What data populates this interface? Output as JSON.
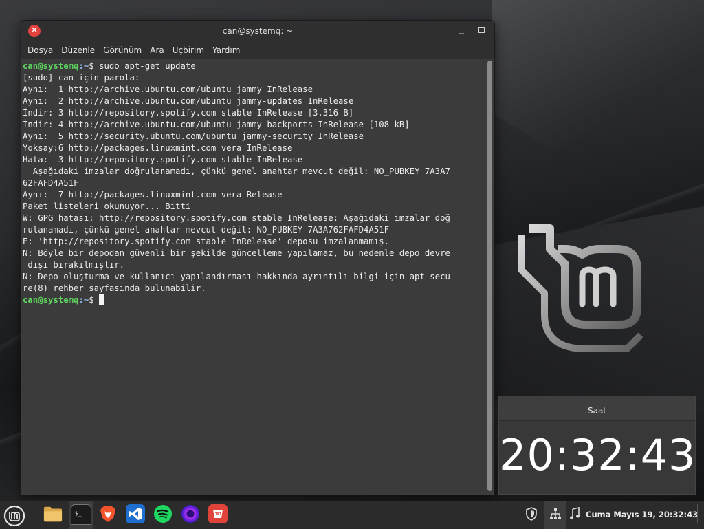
{
  "window": {
    "title": "can@systemq: ~",
    "close_glyph": "✕",
    "minimize_glyph": "_",
    "menu": [
      "Dosya",
      "Düzenle",
      "Görünüm",
      "Ara",
      "Uçbirim",
      "Yardım"
    ]
  },
  "terminal": {
    "prompt_user": "can@systemq",
    "prompt_path": ":~",
    "prompt_symbol": "$ ",
    "command": "sudo apt-get update",
    "output": [
      "[sudo] can için parola:",
      "Aynı:  1 http://archive.ubuntu.com/ubuntu jammy InRelease",
      "Aynı:  2 http://archive.ubuntu.com/ubuntu jammy-updates InRelease",
      "İndir: 3 http://repository.spotify.com stable InRelease [3.316 B]",
      "İndir: 4 http://archive.ubuntu.com/ubuntu jammy-backports InRelease [108 kB]",
      "Aynı:  5 http://security.ubuntu.com/ubuntu jammy-security InRelease",
      "Yoksay:6 http://packages.linuxmint.com vera InRelease",
      "Hata:  3 http://repository.spotify.com stable InRelease",
      "  Aşağıdaki imzalar doğrulanamadı, çünkü genel anahtar mevcut değil: NO_PUBKEY 7A3A7",
      "62FAFD4A51F",
      "Aynı:  7 http://packages.linuxmint.com vera Release",
      "Paket listeleri okunuyor... Bitti",
      "W: GPG hatası: http://repository.spotify.com stable InRelease: Aşağıdaki imzalar doğ",
      "rulanamadı, çünkü genel anahtar mevcut değil: NO_PUBKEY 7A3A762FAFD4A51F",
      "E: 'http://repository.spotify.com stable InRelease' deposu imzalanmamış.",
      "N: Böyle bir depodan güvenli bir şekilde güncelleme yapılamaz, bu nedenle depo devre",
      " dışı bırakılmıştır.",
      "N: Depo oluşturma ve kullanıcı yapılandırması hakkında ayrıntılı bilgi için apt-secu",
      "re(8) rehber sayfasında bulunabilir."
    ]
  },
  "clock": {
    "title": "Saat",
    "time": "20:32:43"
  },
  "panel": {
    "launchers": [
      "file-manager-icon",
      "terminal-icon",
      "brave-icon",
      "vscode-icon",
      "spotify-icon",
      "firefox-icon",
      "mintinstall-icon"
    ],
    "datetime": "Cuma Mayıs 19, 20:32:43",
    "colors": {
      "prompt_user": "#5fd75f",
      "prompt_path": "#8fb5e8",
      "close_button": "#e2423f",
      "active_indicator": "#e04444"
    }
  }
}
